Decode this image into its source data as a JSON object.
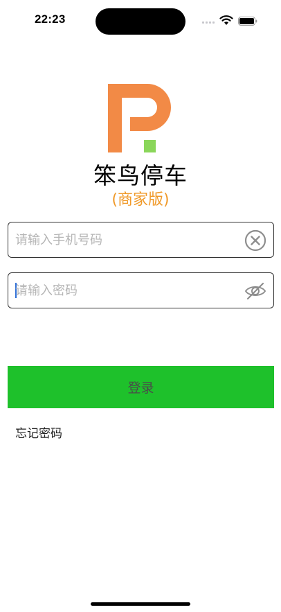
{
  "status_bar": {
    "time": "22:23",
    "icons": [
      "cellular-dots-icon",
      "wifi-icon",
      "battery-icon"
    ]
  },
  "brand": {
    "logo": "cainiao-parking-logo",
    "title": "笨鸟停车",
    "subtitle": "(商家版)",
    "colors": {
      "logo_orange": "#f28a46",
      "logo_green": "#8ad65a",
      "subtitle": "#f09a2a"
    }
  },
  "form": {
    "phone_placeholder": "请输入手机号码",
    "phone_value": "",
    "password_placeholder": "请输入密码",
    "password_value": "",
    "clear_icon": "clear-circle-x-icon",
    "visibility_icon": "eye-slash-icon"
  },
  "actions": {
    "login_label": "登录",
    "login_color": "#1ec12b",
    "forgot_label": "忘记密码"
  }
}
